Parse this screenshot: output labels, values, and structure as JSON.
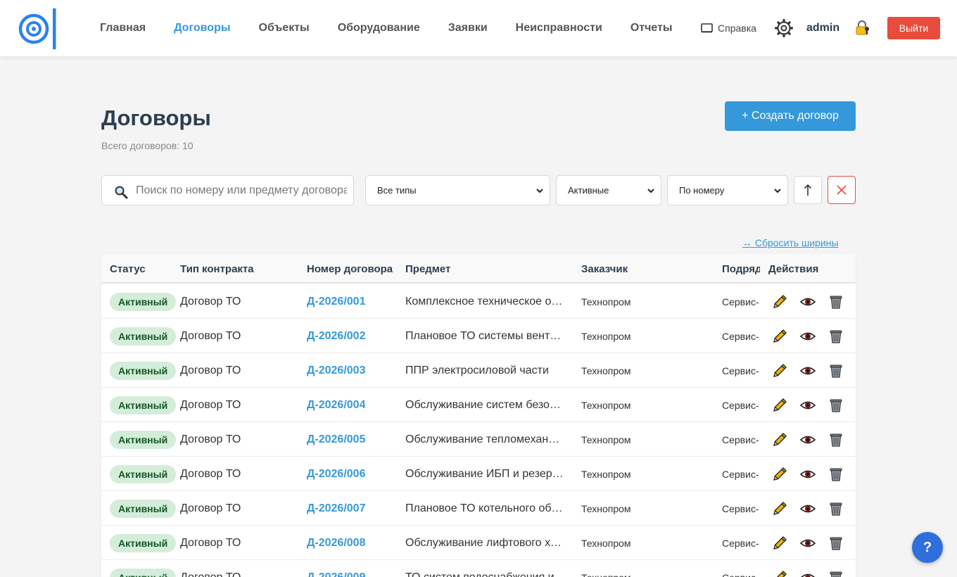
{
  "header": {
    "nav": [
      {
        "label": "Главная",
        "active": false
      },
      {
        "label": "Договоры",
        "active": true
      },
      {
        "label": "Объекты",
        "active": false
      },
      {
        "label": "Оборудование",
        "active": false
      },
      {
        "label": "Заявки",
        "active": false
      },
      {
        "label": "Неисправности",
        "active": false
      },
      {
        "label": "Отчеты",
        "active": false
      }
    ],
    "help_label": "Справка",
    "username": "admin",
    "logout_label": "Выйти"
  },
  "page": {
    "title": "Договоры",
    "count_text": "Всего договоров: 10",
    "create_label": "+ Создать договор"
  },
  "filters": {
    "search_placeholder": "Поиск по номеру или предмету договора",
    "type_selected": "Все типы",
    "status_selected": "Активные",
    "sort_selected": "По номеру",
    "reset_widths_label": "↔ Сбросить ширины"
  },
  "table": {
    "columns": [
      "Статус",
      "Тип контракта",
      "Номер договора",
      "Предмет",
      "Заказчик",
      "Подрядчик",
      "Действия"
    ],
    "rows": [
      {
        "status": "Активный",
        "type": "Договор ТО",
        "number": "Д-2026/001",
        "subject": "Комплексное техническое обслуживание",
        "customer": "Технопром",
        "contractor": "Сервис-"
      },
      {
        "status": "Активный",
        "type": "Договор ТО",
        "number": "Д-2026/002",
        "subject": "Плановое ТО системы вентиляции",
        "customer": "Технопром",
        "contractor": "Сервис-"
      },
      {
        "status": "Активный",
        "type": "Договор ТО",
        "number": "Д-2026/003",
        "subject": "ППР электросиловой части",
        "customer": "Технопром",
        "contractor": "Сервис-"
      },
      {
        "status": "Активный",
        "type": "Договор ТО",
        "number": "Д-2026/004",
        "subject": "Обслуживание систем безопасности",
        "customer": "Технопром",
        "contractor": "Сервис-"
      },
      {
        "status": "Активный",
        "type": "Договор ТО",
        "number": "Д-2026/005",
        "subject": "Обслуживание тепломеханического оборудования",
        "customer": "Технопром",
        "contractor": "Сервис-"
      },
      {
        "status": "Активный",
        "type": "Договор ТО",
        "number": "Д-2026/006",
        "subject": "Обслуживание ИБП и резервного питания",
        "customer": "Технопром",
        "contractor": "Сервис-"
      },
      {
        "status": "Активный",
        "type": "Договор ТО",
        "number": "Д-2026/007",
        "subject": "Плановое ТО котельного оборудования",
        "customer": "Технопром",
        "contractor": "Сервис-"
      },
      {
        "status": "Активный",
        "type": "Договор ТО",
        "number": "Д-2026/008",
        "subject": "Обслуживание лифтового хозяйства",
        "customer": "Технопром",
        "contractor": "Сервис-"
      },
      {
        "status": "Активный",
        "type": "Договор ТО",
        "number": "Д-2026/009",
        "subject": "ТО систем водоснабжения и",
        "customer": "Технопром",
        "contractor": "Сервис-"
      }
    ]
  },
  "fab_label": "?",
  "colors": {
    "accent": "#3498db",
    "danger": "#e74c3c",
    "badge_bg": "#d4edda",
    "badge_text": "#155724",
    "fab": "#2f6fdc"
  }
}
